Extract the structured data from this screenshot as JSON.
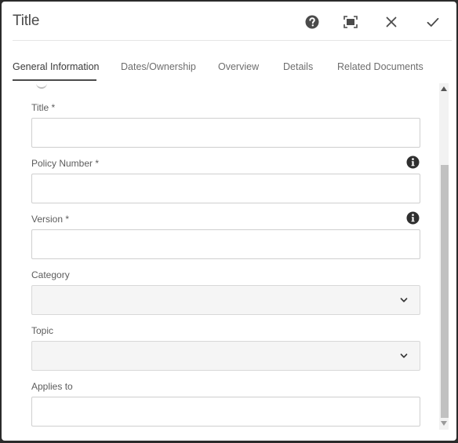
{
  "dialog": {
    "title": "Title",
    "actions": {
      "help": "help-icon",
      "fullscreen": "fullscreen-icon",
      "close": "close-icon",
      "done": "checkmark-icon"
    }
  },
  "tabs": [
    {
      "label": "General Information",
      "active": true
    },
    {
      "label": "Dates/Ownership",
      "active": false
    },
    {
      "label": "Overview",
      "active": false
    },
    {
      "label": "Details",
      "active": false
    },
    {
      "label": "Related Documents",
      "active": false
    }
  ],
  "form": {
    "fields": [
      {
        "label": "Title *",
        "value": "",
        "type": "text",
        "info": false
      },
      {
        "label": "Policy Number *",
        "value": "",
        "type": "text",
        "info": true
      },
      {
        "label": "Version *",
        "value": "",
        "type": "text",
        "info": true
      },
      {
        "label": "Category",
        "value": "",
        "type": "select",
        "info": false
      },
      {
        "label": "Topic",
        "value": "",
        "type": "select",
        "info": false
      },
      {
        "label": "Applies to",
        "value": "",
        "type": "text",
        "info": false
      }
    ]
  },
  "colors": {
    "backdrop": "#2b2b2b",
    "dialog_bg": "#ffffff",
    "text": "#4b4b4b",
    "border": "#cfcfcf",
    "select_bg": "#f5f5f5",
    "scroll_thumb": "#c1c1c1"
  }
}
